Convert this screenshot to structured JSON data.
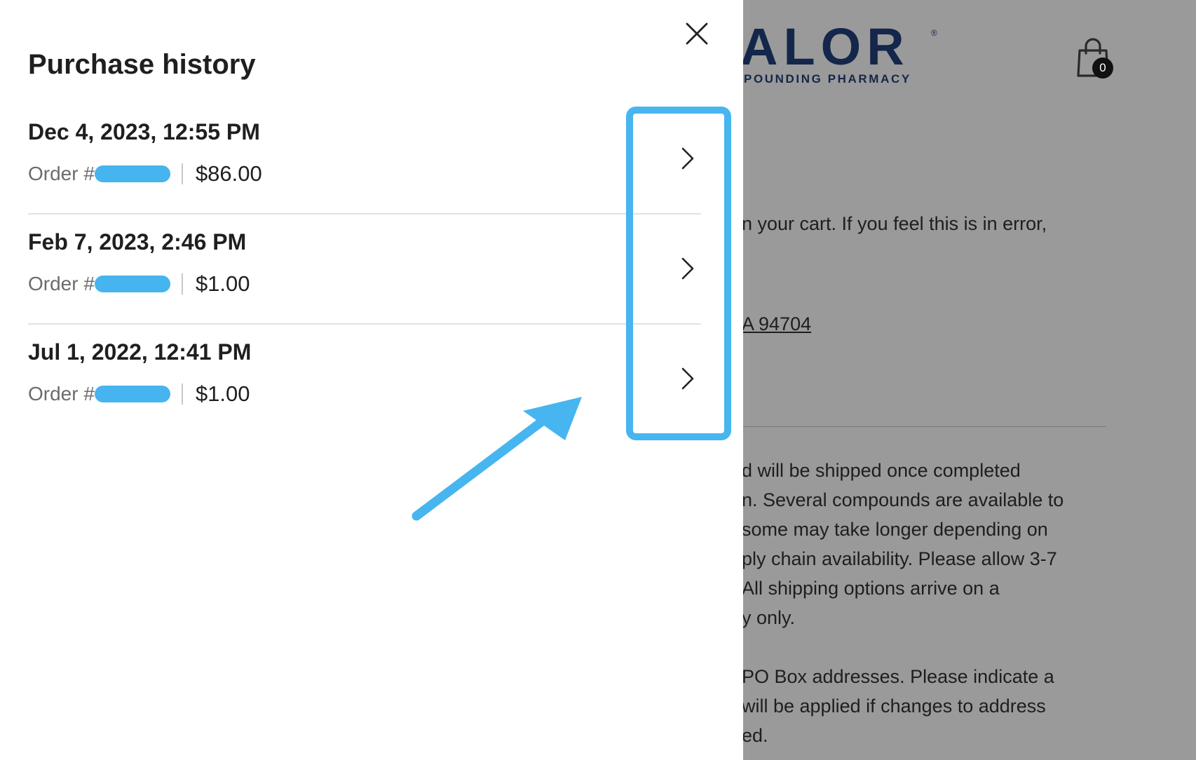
{
  "background": {
    "logo_text": "ALOR",
    "logo_reg": "®",
    "logo_subtitle": "POUNDING PHARMACY",
    "cart_count": "0",
    "lines": {
      "cart_notice": "n your cart. If you feel this is in error,",
      "address": "A 94704",
      "shipping_1": "d will be shipped once completed",
      "shipping_2": "n. Several compounds are available to",
      "shipping_3": "some may take longer depending on",
      "shipping_4": "ply chain availability. Please allow 3-7",
      "shipping_5": " All shipping options arrive on a",
      "shipping_6": "y only.",
      "pobox_1": "PO Box addresses. Please indicate a",
      "pobox_2": " will be applied if changes to address",
      "pobox_3": "ed."
    }
  },
  "drawer": {
    "title": "Purchase history",
    "orders": [
      {
        "date": "Dec 4, 2023, 12:55 PM",
        "order_label": "Order #",
        "total": "$86.00"
      },
      {
        "date": "Feb 7, 2023, 2:46 PM",
        "order_label": "Order #",
        "total": "$1.00"
      },
      {
        "date": "Jul 1, 2022, 12:41 PM",
        "order_label": "Order #",
        "total": "$1.00"
      }
    ]
  },
  "colors": {
    "annotation": "#47b5ef",
    "overlay": "#9a9a9a",
    "brand_navy": "#14264a"
  },
  "icons": {
    "close": "close-icon",
    "chevron": "chevron-right-icon",
    "cart": "shopping-bag-icon",
    "arrow": "annotation-arrow"
  }
}
